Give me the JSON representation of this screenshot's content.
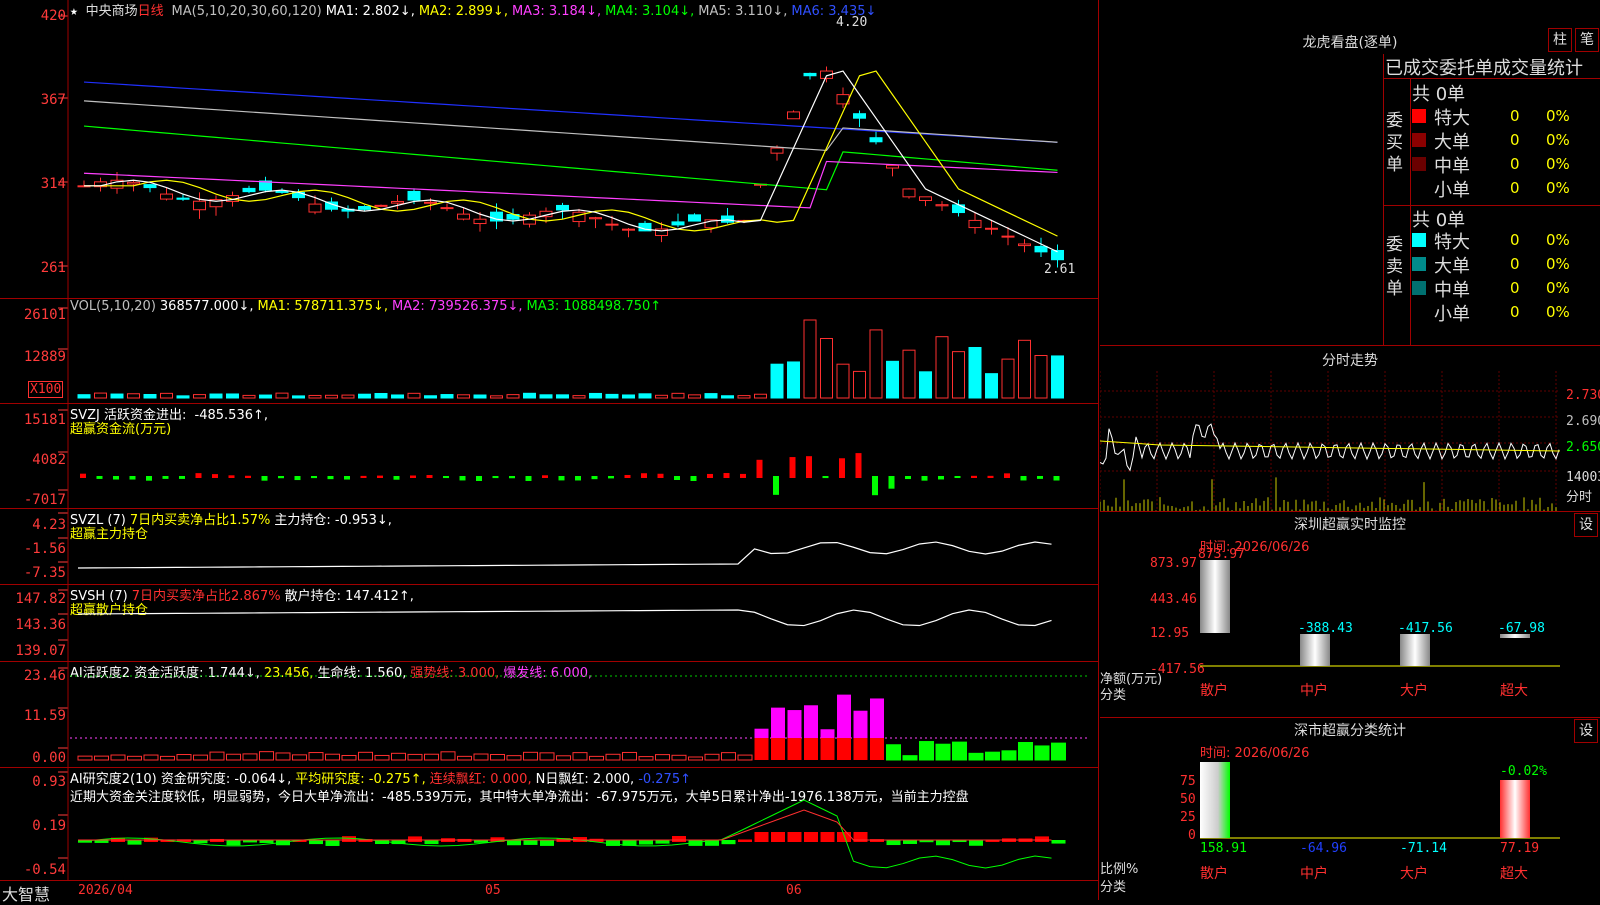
{
  "stock": {
    "name": "中央商场",
    "period": "日线",
    "star": "★"
  },
  "main_chart": {
    "ma_legend": [
      {
        "text": "MA(5,10,20,30,60,120)",
        "color": "#c0c0c0"
      },
      {
        "text": "MA1: 2.802↓,",
        "color": "#ffffff"
      },
      {
        "text": "MA2: 2.899↓,",
        "color": "#ffff00"
      },
      {
        "text": "MA3: 3.184↓,",
        "color": "#ff40ff"
      },
      {
        "text": "MA4: 3.104↓,",
        "color": "#00ff00"
      },
      {
        "text": "MA5: 3.110↓,",
        "color": "#c0c0c0"
      },
      {
        "text": "MA6: 3.435↓",
        "color": "#3050ff"
      }
    ],
    "y_labels": [
      "420",
      "367",
      "314",
      "261"
    ],
    "high_label": "4.20",
    "low_label": "2.61"
  },
  "vol_pane": {
    "legend": [
      {
        "text": "VOL(5,10,20)",
        "color": "#c0c0c0"
      },
      {
        "text": "368577.000↓,",
        "color": "#ffffff"
      },
      {
        "text": "MA1: 578711.375↓,",
        "color": "#ffff00"
      },
      {
        "text": "MA2: 739526.375↓,",
        "color": "#ff40ff"
      },
      {
        "text": "MA3: 1088498.750↑",
        "color": "#00ff00"
      }
    ],
    "y_labels": [
      "26101",
      "12889"
    ],
    "unit": "X100"
  },
  "svzj_pane": {
    "line1": [
      {
        "text": "SVZJ  活跃资金进出: ",
        "color": "#ffffff"
      },
      {
        "text": "-485.536↑,",
        "color": "#ffffff"
      }
    ],
    "title": "超赢资金流(万元)",
    "y_labels": [
      "15181",
      "4082",
      "-7017"
    ]
  },
  "svzl_pane": {
    "line1": [
      {
        "text": "SVZL (7)",
        "color": "#ffffff"
      },
      {
        "text": "7日内买卖净占比1.57%",
        "color": "#ffff00"
      },
      {
        "text": "主力持仓: -0.953↓,",
        "color": "#ffffff"
      }
    ],
    "title": "超赢主力持仓",
    "y_labels": [
      "4.23",
      "-1.56",
      "-7.35"
    ]
  },
  "svsh_pane": {
    "line1": [
      {
        "text": "SVSH (7)",
        "color": "#ffffff"
      },
      {
        "text": "7日内买卖净占比2.867%",
        "color": "#ff3030"
      },
      {
        "text": "散户持仓: 147.412↑,",
        "color": "#ffffff"
      }
    ],
    "title": "超赢散户持仓",
    "y_labels": [
      "147.82",
      "143.36",
      "139.07"
    ]
  },
  "ai_active_pane": {
    "legend": [
      {
        "text": "AI活跃度2 资金活跃度: 1.744↓,",
        "color": "#ffffff"
      },
      {
        "text": "23.456,",
        "color": "#ffff00"
      },
      {
        "text": "生命线: 1.560,",
        "color": "#ffffff"
      },
      {
        "text": "强势线: 3.000,",
        "color": "#ff3030"
      },
      {
        "text": "爆发线: 6.000,",
        "color": "#ff40ff"
      }
    ],
    "y_labels": [
      "23.46",
      "11.59",
      "0.00"
    ]
  },
  "ai_research_pane": {
    "legend": [
      {
        "text": "AI研究度2(10) 资金研究度: -0.064↓,",
        "color": "#ffffff"
      },
      {
        "text": "平均研究度: -0.275↑,",
        "color": "#ffff00"
      },
      {
        "text": "连续飘红: 0.000,",
        "color": "#ff3030"
      },
      {
        "text": "N日飘红: 2.000,",
        "color": "#ffffff"
      },
      {
        "text": "-0.275↑",
        "color": "#3050ff"
      }
    ],
    "comment": "近期大资金关注度较低，明显弱势，今日大单净流出：-485.539万元，其中特大单净流出：-67.975万元，大单5日累计净出-1976.138万元，当前主力控盘",
    "y_labels": [
      "0.93",
      "0.19",
      "-0.54"
    ]
  },
  "bottom_bar": {
    "brand": "大智慧",
    "dates": [
      "2026/04",
      "05",
      "06"
    ]
  },
  "longhu": {
    "title": "龙虎看盘(逐单)",
    "btn_bar": "柱",
    "btn_note": "笔",
    "section_title": "已成交委托单成交量统计",
    "buy_label": "委买单",
    "sell_label": "委卖单",
    "buy_total": "共 0单",
    "sell_total": "共 0单",
    "buy_rows": [
      {
        "label": "特大",
        "count": "0",
        "pct": "0%",
        "color": "#ff0000"
      },
      {
        "label": "大单",
        "count": "0",
        "pct": "0%",
        "color": "#8b0000"
      },
      {
        "label": "中单",
        "count": "0",
        "pct": "0%",
        "color": "#6a0000"
      },
      {
        "label": "小单",
        "count": "0",
        "pct": "0%",
        "color": ""
      }
    ],
    "sell_rows": [
      {
        "label": "特大",
        "count": "0",
        "pct": "0%",
        "color": "#00ffff"
      },
      {
        "label": "大单",
        "count": "0",
        "pct": "0%",
        "color": "#008b8b"
      },
      {
        "label": "中单",
        "count": "0",
        "pct": "0%",
        "color": "#007070"
      },
      {
        "label": "小单",
        "count": "0",
        "pct": "0%",
        "color": ""
      }
    ]
  },
  "intraday": {
    "title": "分时走势",
    "prices": [
      "2.730",
      "2.690",
      "2.650"
    ],
    "volume_label": "14003",
    "unit_label": "分时"
  },
  "monitor": {
    "title": "深圳超赢实时监控",
    "settings": "设",
    "time": "时间: 2026/06/26",
    "y_labels": [
      "873.97",
      "443.46",
      "12.95",
      "-417.56"
    ],
    "axis_label": "净额(万元)",
    "cat_label": "分类",
    "categories": [
      "散户",
      "中户",
      "大户",
      "超大"
    ],
    "values": [
      "873.97",
      "-388.43",
      "-417.56",
      "-67.98"
    ]
  },
  "classify": {
    "title": "深市超赢分类统计",
    "settings": "设",
    "time": "时间: 2026/06/26",
    "y_labels": [
      "75",
      "50",
      "25",
      "0"
    ],
    "axis_label": "比例%",
    "cat_label": "分类",
    "categories": [
      "散户",
      "中户",
      "大户",
      "超大"
    ],
    "values": [
      "158.91",
      "-64.96",
      "-71.14",
      "77.19"
    ],
    "top_label": "-0.02%"
  }
}
